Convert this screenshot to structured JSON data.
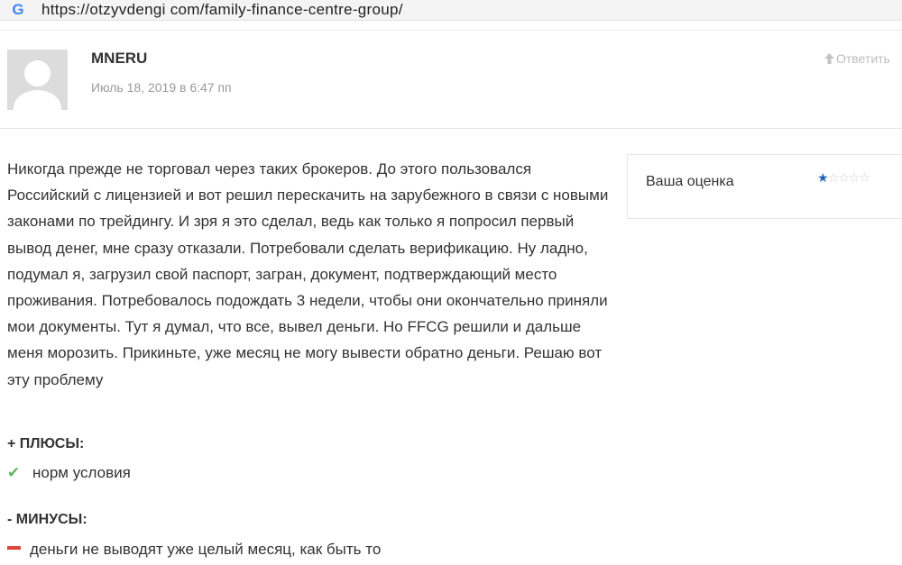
{
  "browser": {
    "url": "https://otzyvdengi com/family-finance-centre-group/",
    "icon": "google-g-icon"
  },
  "comment": {
    "author": "MNERU",
    "date": "Июль 18, 2019 в 6:47 пп",
    "reply_label": "Ответить",
    "avatar": "default-avatar-icon",
    "text": "Никогда прежде не торговал через таких брокеров. До этого пользовался Российский с лицензией и вот решил перескачить на зарубежного в связи с новыми законами по трейдингу. И зря я это сделал, ведь как только я попросил первый вывод денег, мне сразу отказали. Потребовали сделать верификацию. Ну ладно, подумал я, загрузил свой паспорт, загран, документ, подтверждающий место проживания. Потребовалось подождать 3 недели, чтобы они окончательно приняли мои документы. Тут я думал, что все, вывел деньги. Но FFCG решили и дальше меня морозить. Прикиньте, уже месяц не могу вывести обратно деньги. Решаю вот эту проблему"
  },
  "rating": {
    "label": "Ваша оценка",
    "value": 1,
    "max": 5,
    "filled_color": "#1e64b8",
    "empty_color": "#cfcfcf"
  },
  "pros": {
    "title": "+ ПЛЮСЫ:",
    "items": [
      "норм условия"
    ],
    "icon": "checkmark-icon",
    "color": "#5cb85c"
  },
  "cons": {
    "title": "- МИНУСЫ:",
    "items": [
      "деньги не выводят уже целый месяц, как быть то"
    ],
    "icon": "minus-icon",
    "color": "#e0463c"
  }
}
